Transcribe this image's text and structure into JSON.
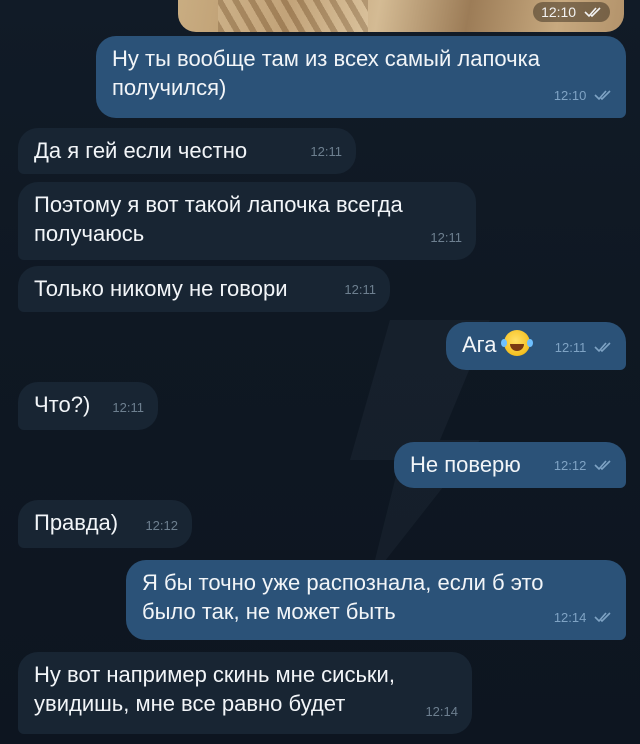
{
  "photo": {
    "time": "12:10"
  },
  "messages": [
    {
      "id": "m1",
      "dir": "out",
      "lines": [
        "Ну ты вообще там из всех самый лапочка",
        "получился)"
      ],
      "time": "12:10",
      "read": true
    },
    {
      "id": "m2",
      "dir": "in",
      "lines": [
        "Да я гей если честно"
      ],
      "time": "12:11"
    },
    {
      "id": "m3",
      "dir": "in",
      "lines": [
        "Поэтому я вот такой лапочка всегда",
        "получаюсь"
      ],
      "time": "12:11"
    },
    {
      "id": "m4",
      "dir": "in",
      "lines": [
        "Только никому не говори"
      ],
      "time": "12:11"
    },
    {
      "id": "m5",
      "dir": "out",
      "lines": [
        "Ага"
      ],
      "emoji": "face-with-tears-of-joy",
      "time": "12:11",
      "read": true
    },
    {
      "id": "m6",
      "dir": "in",
      "lines": [
        "Что?)"
      ],
      "time": "12:11"
    },
    {
      "id": "m7",
      "dir": "out",
      "lines": [
        "Не поверю"
      ],
      "time": "12:12",
      "read": true
    },
    {
      "id": "m8",
      "dir": "in",
      "lines": [
        "Правда)"
      ],
      "time": "12:12"
    },
    {
      "id": "m9",
      "dir": "out",
      "lines": [
        "Я бы точно уже распознала, если б это",
        "было так, не может быть"
      ],
      "time": "12:14",
      "read": true
    },
    {
      "id": "m10",
      "dir": "in",
      "lines": [
        "Ну вот например скинь мне сиськи,",
        "увидишь, мне все равно будет"
      ],
      "time": "12:14"
    }
  ],
  "icons": {
    "read_receipt": "double-check-icon",
    "emoji": "face-with-tears-of-joy"
  }
}
